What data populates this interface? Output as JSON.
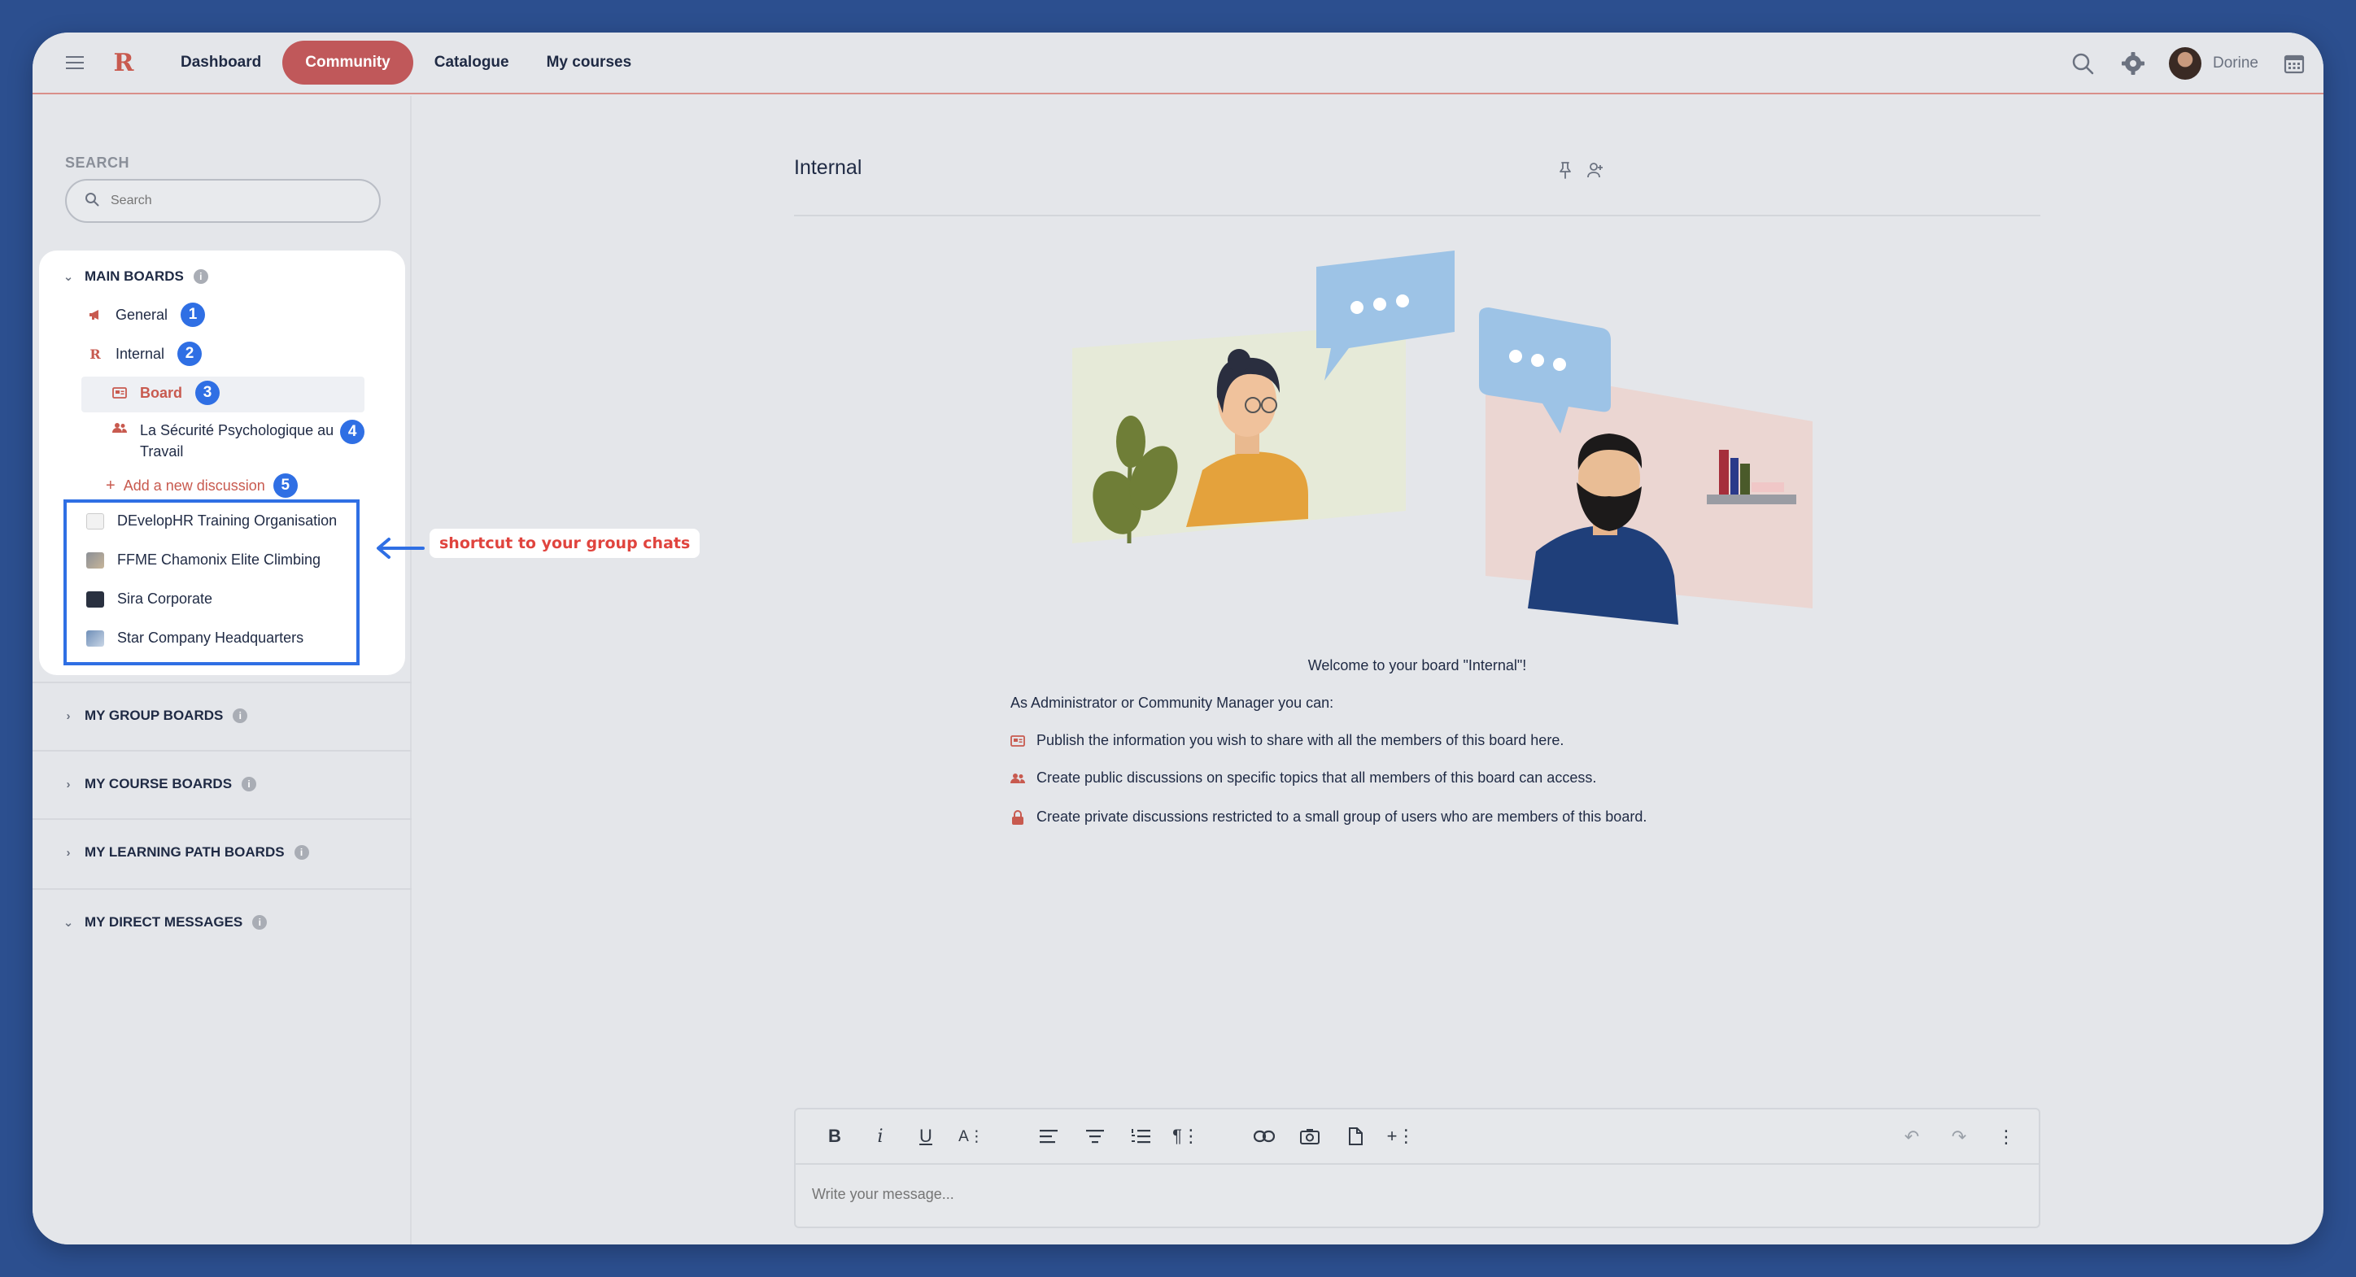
{
  "topbar": {
    "nav": [
      "Dashboard",
      "Community",
      "Catalogue",
      "My courses"
    ],
    "active_nav": "Community",
    "user_name": "Dorine"
  },
  "sidebar": {
    "search_label": "SEARCH",
    "search_placeholder": "Search",
    "main_boards": {
      "title": "MAIN BOARDS",
      "items": [
        {
          "label": "General",
          "badge": "1",
          "icon": "megaphone-icon"
        },
        {
          "label": "Internal",
          "badge": "2",
          "icon": "logo-r-icon"
        },
        {
          "label": "Board",
          "badge": "3",
          "icon": "board-icon"
        },
        {
          "label": "La Sécurité Psychologique au",
          "label2": "Travail",
          "badge": "4",
          "icon": "users-icon"
        },
        {
          "label": "Add a new discussion",
          "badge": "5",
          "icon": "plus-icon"
        }
      ],
      "groups": [
        "DEvelopHR Training Organisation",
        "FFME Chamonix Elite Climbing",
        "Sira Corporate",
        "Star Company Headquarters"
      ]
    },
    "sections": [
      "MY GROUP BOARDS",
      "MY COURSE BOARDS",
      "MY LEARNING PATH BOARDS",
      "MY DIRECT MESSAGES"
    ]
  },
  "annotation": {
    "label": "shortcut to your group chats",
    "color": "#e0443e",
    "box_color": "#2f6fe4"
  },
  "main": {
    "title": "Internal",
    "welcome": "Welcome to your board \"Internal\"!",
    "admin_line": "As Administrator or Community Manager you can:",
    "bullets": [
      {
        "text": "Publish the information you wish to share with all the members of this board here.",
        "icon": "board-icon"
      },
      {
        "text": "Create public discussions on specific topics that all members of this board can access.",
        "icon": "users-icon"
      },
      {
        "text": "Create private discussions restricted to a small group of users who are members of this board.",
        "icon": "lock-icon"
      }
    ]
  },
  "editor": {
    "placeholder": "Write your message..."
  },
  "colors": {
    "accent": "#c0585a",
    "badge": "#2f6fe4"
  }
}
